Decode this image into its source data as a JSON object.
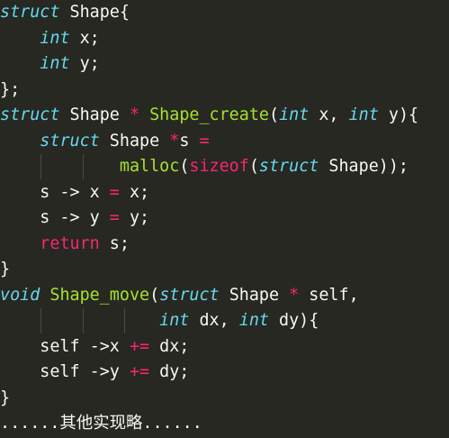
{
  "editor": {
    "colors": {
      "background": "#272822",
      "text": "#f8f8f2",
      "keyword_type": "#66d9ef",
      "keyword_control": "#f92672",
      "operator": "#f92672",
      "function": "#a6e22e",
      "indent_guide": "#4a4a42"
    },
    "lines": [
      [
        {
          "t": "struct",
          "c": "kw-type"
        },
        {
          "t": " Shape{",
          "c": "plain"
        }
      ],
      [
        {
          "t": "    ",
          "c": "plain"
        },
        {
          "t": "int",
          "c": "kw-type"
        },
        {
          "t": " x;",
          "c": "plain"
        }
      ],
      [
        {
          "t": "    ",
          "c": "plain"
        },
        {
          "t": "int",
          "c": "kw-type"
        },
        {
          "t": " y;",
          "c": "plain"
        }
      ],
      [
        {
          "t": "};",
          "c": "plain"
        }
      ],
      [
        {
          "t": "struct",
          "c": "kw-type"
        },
        {
          "t": " Shape ",
          "c": "plain"
        },
        {
          "t": "*",
          "c": "op"
        },
        {
          "t": " ",
          "c": "plain"
        },
        {
          "t": "Shape_create",
          "c": "fn"
        },
        {
          "t": "(",
          "c": "plain"
        },
        {
          "t": "int",
          "c": "kw-type"
        },
        {
          "t": " x, ",
          "c": "plain"
        },
        {
          "t": "int",
          "c": "kw-type"
        },
        {
          "t": " y){",
          "c": "plain"
        }
      ],
      [
        {
          "t": "    ",
          "c": "plain"
        },
        {
          "t": "struct",
          "c": "kw-type"
        },
        {
          "t": " Shape ",
          "c": "plain"
        },
        {
          "t": "*",
          "c": "op"
        },
        {
          "t": "s ",
          "c": "plain"
        },
        {
          "t": "=",
          "c": "op"
        }
      ],
      [
        {
          "t": "            ",
          "c": "plain"
        },
        {
          "t": "malloc",
          "c": "fn"
        },
        {
          "t": "(",
          "c": "plain"
        },
        {
          "t": "sizeof",
          "c": "kw-ctrl"
        },
        {
          "t": "(",
          "c": "plain"
        },
        {
          "t": "struct",
          "c": "kw-type"
        },
        {
          "t": " Shape));",
          "c": "plain"
        }
      ],
      [
        {
          "t": "    s -> x ",
          "c": "plain"
        },
        {
          "t": "=",
          "c": "op"
        },
        {
          "t": " x;",
          "c": "plain"
        }
      ],
      [
        {
          "t": "    s -> y ",
          "c": "plain"
        },
        {
          "t": "=",
          "c": "op"
        },
        {
          "t": " y;",
          "c": "plain"
        }
      ],
      [
        {
          "t": "    ",
          "c": "plain"
        },
        {
          "t": "return",
          "c": "kw-ctrl"
        },
        {
          "t": " s;",
          "c": "plain"
        }
      ],
      [
        {
          "t": "}",
          "c": "plain"
        }
      ],
      [
        {
          "t": "void",
          "c": "kw-type"
        },
        {
          "t": " ",
          "c": "plain"
        },
        {
          "t": "Shape_move",
          "c": "fn"
        },
        {
          "t": "(",
          "c": "plain"
        },
        {
          "t": "struct",
          "c": "kw-type"
        },
        {
          "t": " Shape ",
          "c": "plain"
        },
        {
          "t": "*",
          "c": "op"
        },
        {
          "t": " self,",
          "c": "plain"
        }
      ],
      [
        {
          "t": "                ",
          "c": "plain"
        },
        {
          "t": "int",
          "c": "kw-type"
        },
        {
          "t": " dx, ",
          "c": "plain"
        },
        {
          "t": "int",
          "c": "kw-type"
        },
        {
          "t": " dy){",
          "c": "plain"
        }
      ],
      [
        {
          "t": "    self ->x ",
          "c": "plain"
        },
        {
          "t": "+=",
          "c": "op"
        },
        {
          "t": " dx;",
          "c": "plain"
        }
      ],
      [
        {
          "t": "    self ->y ",
          "c": "plain"
        },
        {
          "t": "+=",
          "c": "op"
        },
        {
          "t": " dy;",
          "c": "plain"
        }
      ],
      [
        {
          "t": "}",
          "c": "plain"
        }
      ],
      [
        {
          "t": "......其他实现略......",
          "c": "plain"
        }
      ]
    ]
  }
}
